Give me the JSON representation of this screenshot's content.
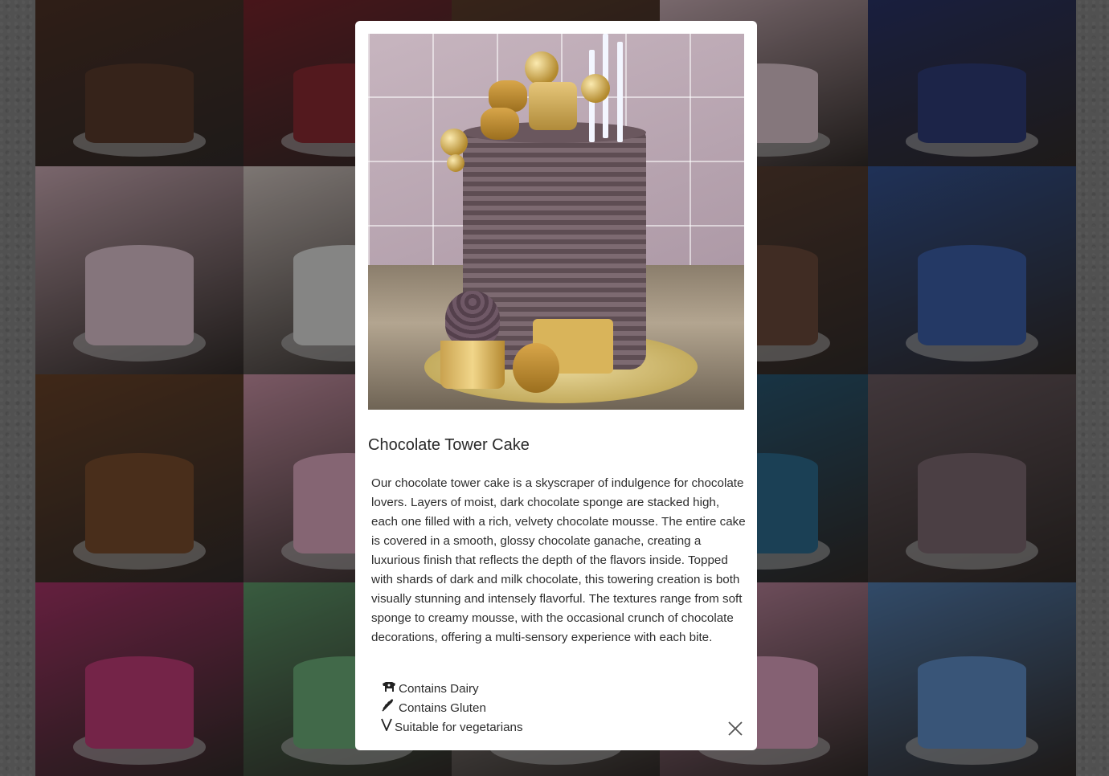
{
  "modal": {
    "title": "Chocolate Tower Cake",
    "description": "Our chocolate tower cake is a skyscraper of indulgence for chocolate lovers. Layers of moist, dark chocolate sponge are stacked high, each one filled with a rich, velvety chocolate mousse. The entire cake is covered in a smooth, glossy chocolate ganache, creating a luxurious finish that reflects the depth of the flavors inside. Topped with shards of dark and milk chocolate, this towering creation is both visually stunning and intensely flavorful. The textures range from soft sponge to creamy mousse, with the occasional crunch of chocolate decorations, offering a multi-sensory experience with each bite.",
    "dietary": [
      {
        "icon": "cow-icon",
        "label": "Contains Dairy"
      },
      {
        "icon": "wheat-icon",
        "label": "Contains Gluten"
      },
      {
        "icon": "vegetarian-v-icon",
        "label": "Suitable for vegetarians"
      }
    ],
    "close_icon": "close-icon"
  },
  "gallery": {
    "tiles": [
      {
        "name": "brownie-tray",
        "color": "#5a3a2c"
      },
      {
        "name": "berry-pavlova",
        "color": "#8a2a33"
      },
      {
        "name": "chocolate-bar-cake",
        "color": "#6a4530"
      },
      {
        "name": "pink-flower-cake",
        "color": "#e6c7cf"
      },
      {
        "name": "galaxy-cake",
        "color": "#303c78"
      },
      {
        "name": "butterfly-birthday-cake",
        "color": "#e9c4cf"
      },
      {
        "name": "raspberry-cheesecake",
        "color": "#efe2dc"
      },
      {
        "name": "hidden-tile",
        "color": "#cfc6c0"
      },
      {
        "name": "mallow-pie",
        "color": "#6b4a3a"
      },
      {
        "name": "flag-cupcakes",
        "color": "#3c5fa8"
      },
      {
        "name": "drip-stripe-cake",
        "color": "#7a4d2e"
      },
      {
        "name": "rainbow-unicorn-cake",
        "color": "#e9a9bf"
      },
      {
        "name": "hidden-tile",
        "color": "#cfc6c0"
      },
      {
        "name": "happy-birthday-candle-cake",
        "color": "#2d6b8f"
      },
      {
        "name": "chocolate-tower-cake-thumb",
        "color": "#7d6a71"
      },
      {
        "name": "pink-brownie-stacks",
        "color": "#c13d78"
      },
      {
        "name": "rainbow-cupcakes",
        "color": "#6db07a"
      },
      {
        "name": "hidden-tile",
        "color": "#cfc6c0"
      },
      {
        "name": "rainbow-bubble-cake",
        "color": "#e7a2c0"
      },
      {
        "name": "peppa-pig-cake",
        "color": "#5f8fc8"
      }
    ]
  }
}
